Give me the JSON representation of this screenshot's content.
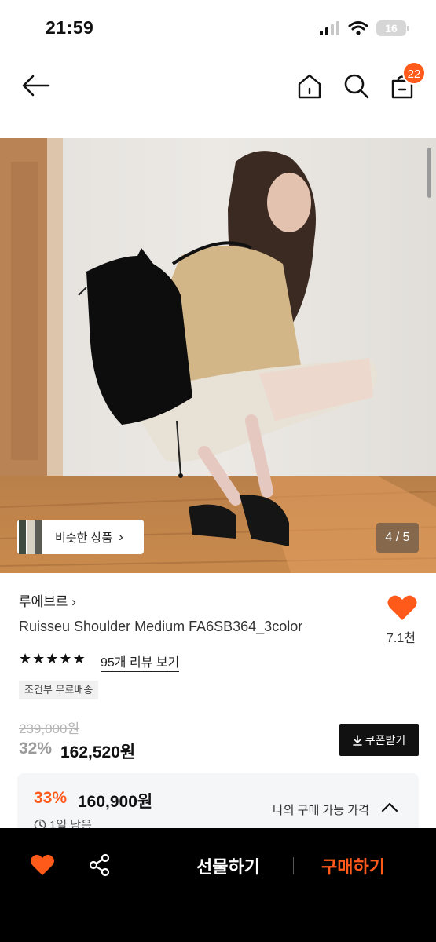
{
  "status_bar": {
    "time": "21:59",
    "battery": "16"
  },
  "nav": {
    "cart_count": "22"
  },
  "gallery": {
    "similar_label": "비슷한 상품",
    "page_indicator": "4 / 5"
  },
  "product": {
    "brand": "루에브르",
    "name": "Ruisseu Shoulder Medium FA6SB364_3color",
    "wish_count": "7.1천",
    "rating_stars": 5,
    "review_link": "95개 리뷰 보기",
    "shipping_tag": "조건부 무료배송",
    "original_price": "239,000원",
    "discount": "32%",
    "price": "162,520원",
    "coupon_button": "쿠폰받기"
  },
  "member_price": {
    "discount": "33%",
    "price": "160,900원",
    "label": "나의 구매 가능 가격",
    "timer": "1일 남음"
  },
  "bottom_bar": {
    "gift_label": "선물하기",
    "buy_label": "구매하기"
  },
  "colors": {
    "accent": "#ff5a1a",
    "dark": "#111111"
  }
}
